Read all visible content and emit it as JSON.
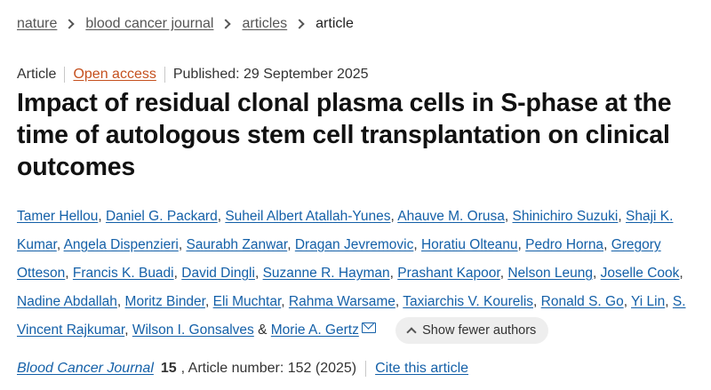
{
  "breadcrumb": {
    "items": [
      "nature",
      "blood cancer journal",
      "articles"
    ],
    "current": "article"
  },
  "meta": {
    "type": "Article",
    "access": "Open access",
    "published": "Published: 29 September 2025"
  },
  "title": "Impact of residual clonal plasma cells in S-phase at the time of autologous stem cell transplantation on clinical outcomes",
  "authors": [
    "Tamer Hellou",
    "Daniel G. Packard",
    "Suheil Albert Atallah-Yunes",
    "Ahauve M. Orusa",
    "Shinichiro Suzuki",
    "Shaji K. Kumar",
    "Angela Dispenzieri",
    "Saurabh Zanwar",
    "Dragan Jevremovic",
    "Horatiu Olteanu",
    "Pedro Horna",
    "Gregory Otteson",
    "Francis K. Buadi",
    "David Dingli",
    "Suzanne R. Hayman",
    "Prashant Kapoor",
    "Nelson Leung",
    "Joselle Cook",
    "Nadine Abdallah",
    "Moritz Binder",
    "Eli Muchtar",
    "Rahma Warsame",
    "Taxiarchis V. Kourelis",
    "Ronald S. Go",
    "Yi Lin",
    "S. Vincent Rajkumar",
    "Wilson I. Gonsalves"
  ],
  "last_author": "Morie A. Gertz",
  "authors_conjunction": "&",
  "mail_icon": "envelope-icon",
  "show_fewer_label": "Show fewer authors",
  "citation": {
    "journal": "Blood Cancer Journal",
    "volume": "15",
    "article_number": ", Article number: 152 (2025)",
    "cite_label": "Cite this article"
  }
}
